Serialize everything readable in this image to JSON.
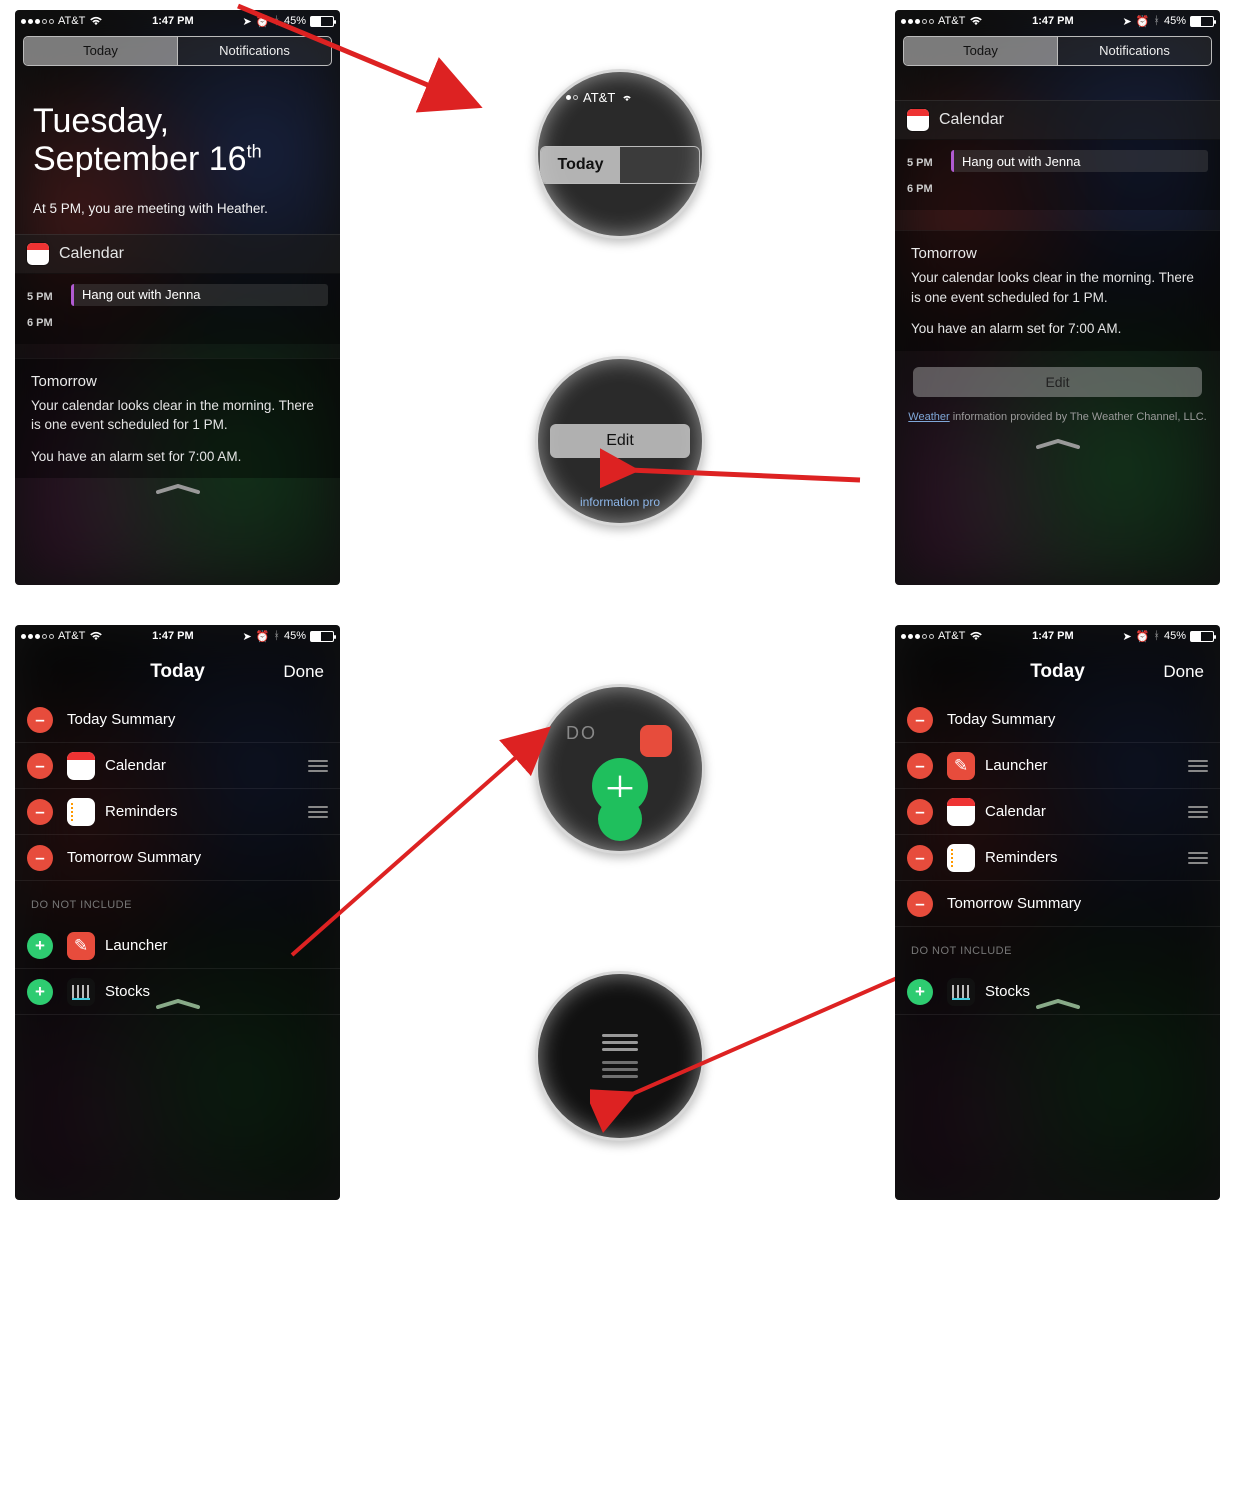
{
  "status": {
    "carrier": "AT&T",
    "time": "1:47 PM",
    "battery_pct": "45%"
  },
  "tabs": {
    "today": "Today",
    "notifications": "Notifications"
  },
  "screen1": {
    "date_line1": "Tuesday,",
    "date_line2_a": "September 16",
    "date_line2_sup": "th",
    "summary": "At 5 PM, you are meeting with Heather.",
    "calendar_title": "Calendar",
    "time1": "5 PM",
    "time2": "6 PM",
    "event": "Hang out with Jenna",
    "tomorrow_title": "Tomorrow",
    "tomorrow_body": "Your calendar looks clear in the morning. There is one event scheduled for 1 PM.",
    "alarm": "You have an alarm set for 7:00 AM."
  },
  "screen2": {
    "calendar_title": "Calendar",
    "time1": "5 PM",
    "time2": "6 PM",
    "event": "Hang out with Jenna",
    "tomorrow_title": "Tomorrow",
    "tomorrow_body": "Your calendar looks clear in the morning. There is one event scheduled for 1 PM.",
    "alarm": "You have an alarm set for 7:00 AM.",
    "edit_label": "Edit",
    "weather_a": "Weather",
    "weather_b": " information provided by The Weather Channel, LLC."
  },
  "edit": {
    "nav_title": "Today",
    "done": "Done",
    "do_not_include": "DO NOT INCLUDE"
  },
  "screen3": {
    "rows": [
      {
        "ctrl": "minus",
        "icon": "",
        "label": "Today Summary",
        "grip": false
      },
      {
        "ctrl": "minus",
        "icon": "cal",
        "label": "Calendar",
        "grip": true
      },
      {
        "ctrl": "minus",
        "icon": "rem",
        "label": "Reminders",
        "grip": true
      },
      {
        "ctrl": "minus",
        "icon": "",
        "label": "Tomorrow Summary",
        "grip": false
      }
    ],
    "excluded": [
      {
        "ctrl": "plus",
        "icon": "lau",
        "label": "Launcher"
      },
      {
        "ctrl": "plus",
        "icon": "stk",
        "label": "Stocks"
      }
    ]
  },
  "screen4": {
    "rows": [
      {
        "ctrl": "minus",
        "icon": "",
        "label": "Today Summary",
        "grip": false
      },
      {
        "ctrl": "minus",
        "icon": "lau",
        "label": "Launcher",
        "grip": true
      },
      {
        "ctrl": "minus",
        "icon": "cal",
        "label": "Calendar",
        "grip": true
      },
      {
        "ctrl": "minus",
        "icon": "rem",
        "label": "Reminders",
        "grip": true
      },
      {
        "ctrl": "minus",
        "icon": "",
        "label": "Tomorrow Summary",
        "grip": false
      }
    ],
    "excluded": [
      {
        "ctrl": "plus",
        "icon": "stk",
        "label": "Stocks"
      }
    ]
  },
  "zoom": {
    "today": "Today",
    "edit": "Edit",
    "edit_under": "information pro"
  }
}
